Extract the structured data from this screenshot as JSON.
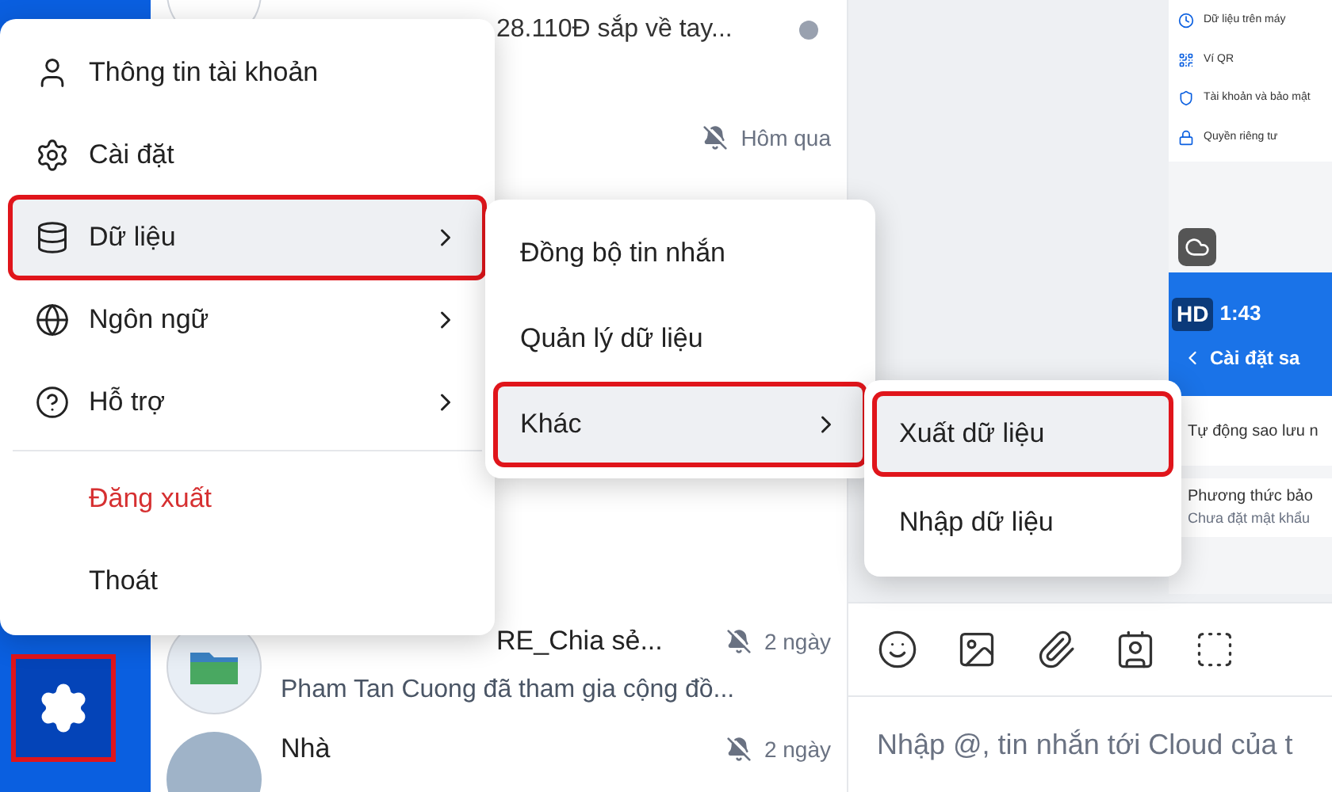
{
  "sidebar": {
    "settings_button": {
      "outlined": true
    }
  },
  "chat_list": [
    {
      "kind": "pay",
      "preview": "28.110Đ sắp về tay...",
      "unread": true,
      "muted": false
    },
    {
      "kind": "plain",
      "time": "Hôm qua",
      "unread": false,
      "muted": true
    },
    {
      "kind": "group",
      "name": "RE_Chia sẻ...",
      "preview": "Pham Tan Cuong đã tham gia cộng đồ...",
      "time": "2 ngày",
      "unread": false,
      "muted": true
    },
    {
      "kind": "photo",
      "name": "Nhà",
      "time": "2 ngày",
      "unread": false,
      "muted": true
    }
  ],
  "main_menu": [
    {
      "kind": "user",
      "label": "Thông tin tài khoản",
      "selected": false,
      "submenu": false,
      "outlined": false,
      "danger": false
    },
    {
      "kind": "gear",
      "label": "Cài đặt",
      "selected": false,
      "submenu": false,
      "outlined": false,
      "danger": false
    },
    {
      "kind": "database",
      "label": "Dữ liệu",
      "selected": true,
      "submenu": true,
      "outlined": true,
      "danger": false
    },
    {
      "kind": "globe",
      "label": "Ngôn ngữ",
      "selected": false,
      "submenu": true,
      "outlined": false,
      "danger": false
    },
    {
      "kind": "help",
      "label": "Hỗ trợ",
      "selected": false,
      "submenu": true,
      "outlined": false,
      "danger": false
    },
    {
      "kind": "divider"
    },
    {
      "kind": "none",
      "label": "Đăng xuất",
      "selected": false,
      "submenu": false,
      "outlined": false,
      "danger": true
    },
    {
      "kind": "none",
      "label": "Thoát",
      "selected": false,
      "submenu": false,
      "outlined": false,
      "danger": false
    }
  ],
  "data_menu": [
    {
      "label": "Đồng bộ tin nhắn",
      "selected": false,
      "submenu": false,
      "outlined": false
    },
    {
      "label": "Quản lý dữ liệu",
      "selected": false,
      "submenu": false,
      "outlined": false
    },
    {
      "label": "Khác",
      "selected": true,
      "submenu": true,
      "outlined": true
    }
  ],
  "other_menu": [
    {
      "label": "Xuất dữ liệu",
      "selected": true,
      "outlined": true
    },
    {
      "label": "Nhập dữ liệu",
      "selected": false,
      "outlined": false
    }
  ],
  "phone_screenshot": {
    "items": [
      "Dữ liệu trên máy",
      "Ví QR",
      "Tài khoản và bảo mật",
      "Quyền riêng tư"
    ],
    "badge": "HD",
    "time": "1:43",
    "header": "Cài đặt sa",
    "rows": [
      "Tự động sao lưu n",
      "Phương thức bảo"
    ],
    "subtext": "Chưa đặt mật khẩu"
  },
  "composer": {
    "placeholder": "Nhập @, tin nhắn tới Cloud của t"
  }
}
